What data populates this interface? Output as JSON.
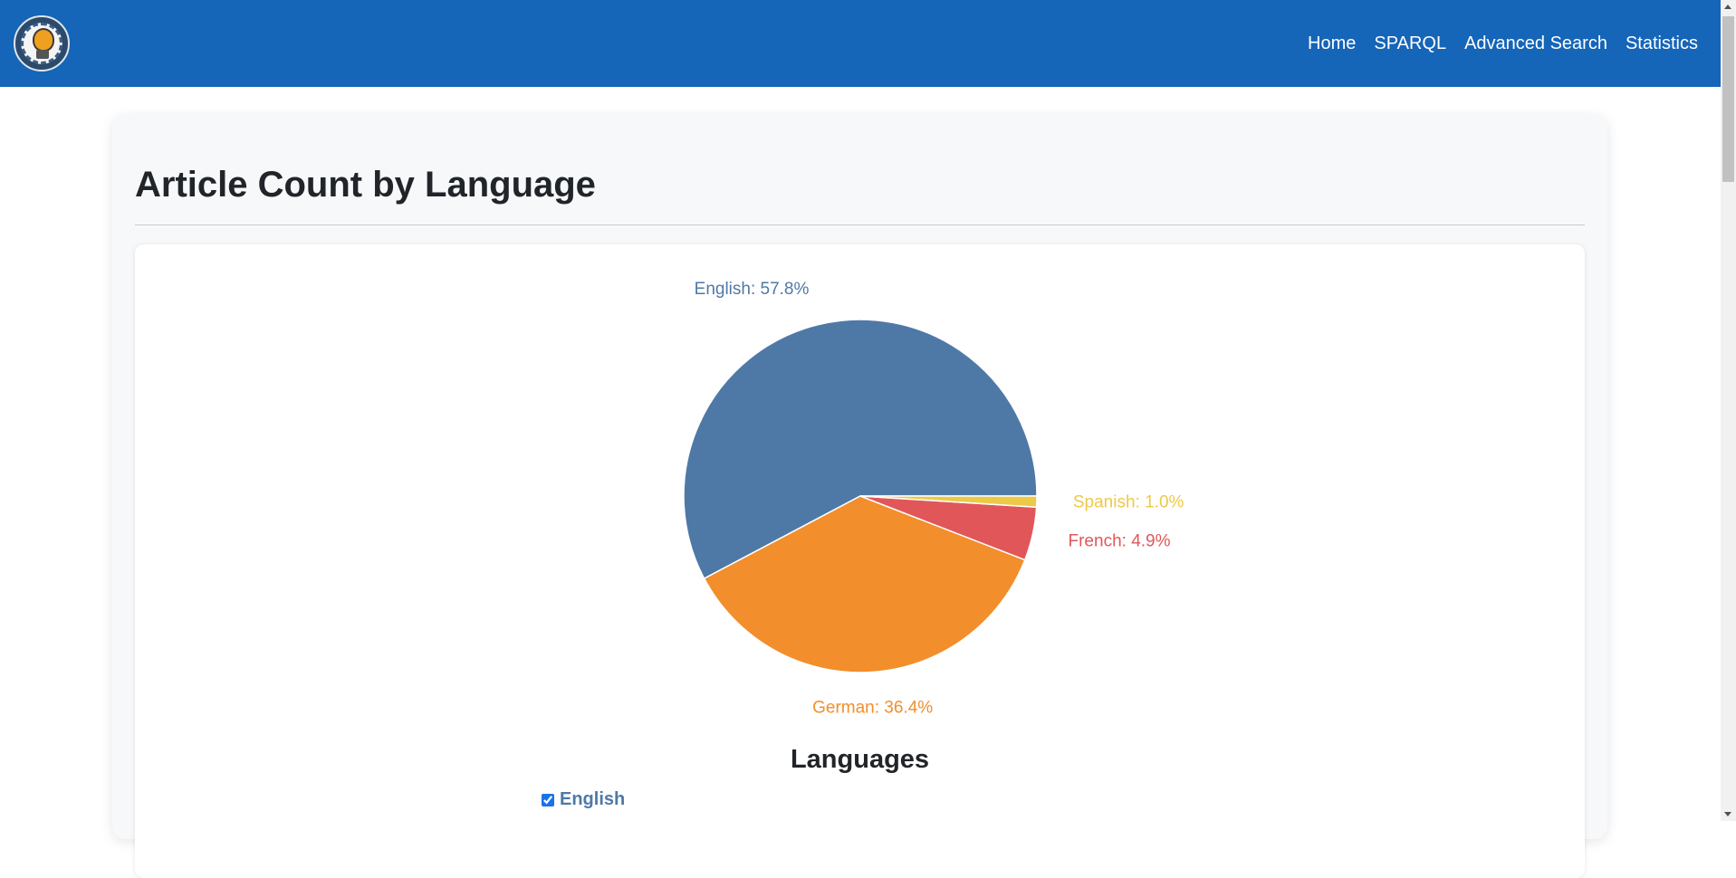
{
  "navbar": {
    "logo_icon": "lightbulb-gear-logo-icon",
    "links": [
      "Home",
      "SPARQL",
      "Advanced Search",
      "Statistics"
    ],
    "bg_color": "#1565b8"
  },
  "page": {
    "title": "Article Count by Language"
  },
  "chart_data": {
    "type": "pie",
    "title": "",
    "series": [
      {
        "name": "English",
        "value": 57.8,
        "label": "English: 57.8%",
        "color": "#4e79a7"
      },
      {
        "name": "German",
        "value": 36.4,
        "label": "German: 36.4%",
        "color": "#f28e2b"
      },
      {
        "name": "French",
        "value": 4.9,
        "label": "French: 4.9%",
        "color": "#e15759"
      },
      {
        "name": "Spanish",
        "value": 1.0,
        "label": "Spanish: 1.0%",
        "color": "#edc948"
      }
    ]
  },
  "legend": {
    "title": "Languages",
    "items": [
      {
        "label": "English",
        "checked": true,
        "color": "#4e79a7"
      }
    ]
  }
}
